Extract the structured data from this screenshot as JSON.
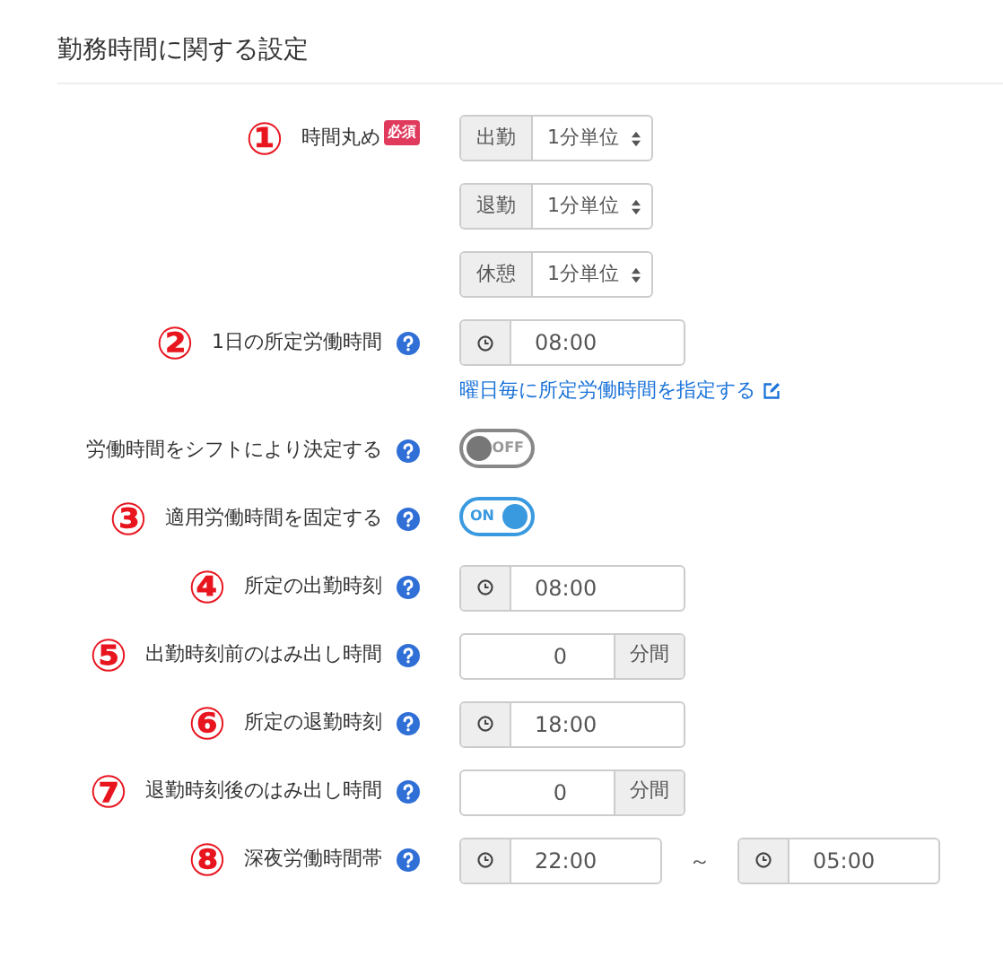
{
  "section_title": "勤務時間に関する設定",
  "rows": [
    {
      "kind": "rounding",
      "marker": "①",
      "label": "時間丸め",
      "badge": "必須",
      "selects": [
        {
          "addon": "出勤",
          "value": "1分単位"
        },
        {
          "addon": "退勤",
          "value": "1分単位"
        },
        {
          "addon": "休憩",
          "value": "1分単位"
        }
      ]
    },
    {
      "kind": "time",
      "marker": "②",
      "label": "1日の所定労働時間",
      "help": true,
      "times": [
        "08:00"
      ],
      "link": "曜日毎に所定労働時間を指定する"
    },
    {
      "kind": "toggle",
      "label": "労働時間をシフトにより決定する",
      "help": true,
      "on": false,
      "toggle_text": "OFF"
    },
    {
      "kind": "toggle",
      "marker": "③",
      "label": "適用労働時間を固定する",
      "help": true,
      "on": true,
      "toggle_text": "ON"
    },
    {
      "kind": "time",
      "marker": "④",
      "label": "所定の出勤時刻",
      "help": true,
      "times": [
        "08:00"
      ]
    },
    {
      "kind": "minutes",
      "marker": "⑤",
      "label": "出勤時刻前のはみ出し時間",
      "help": true,
      "value": "0",
      "unit": "分間"
    },
    {
      "kind": "time",
      "marker": "⑥",
      "label": "所定の退勤時刻",
      "help": true,
      "times": [
        "18:00"
      ]
    },
    {
      "kind": "minutes",
      "marker": "⑦",
      "label": "退勤時刻後のはみ出し時間",
      "help": true,
      "value": "0",
      "unit": "分間"
    },
    {
      "kind": "range",
      "marker": "⑧",
      "label": "深夜労働時間帯",
      "help": true,
      "times": [
        "22:00",
        "05:00"
      ],
      "separator": "～"
    }
  ]
}
